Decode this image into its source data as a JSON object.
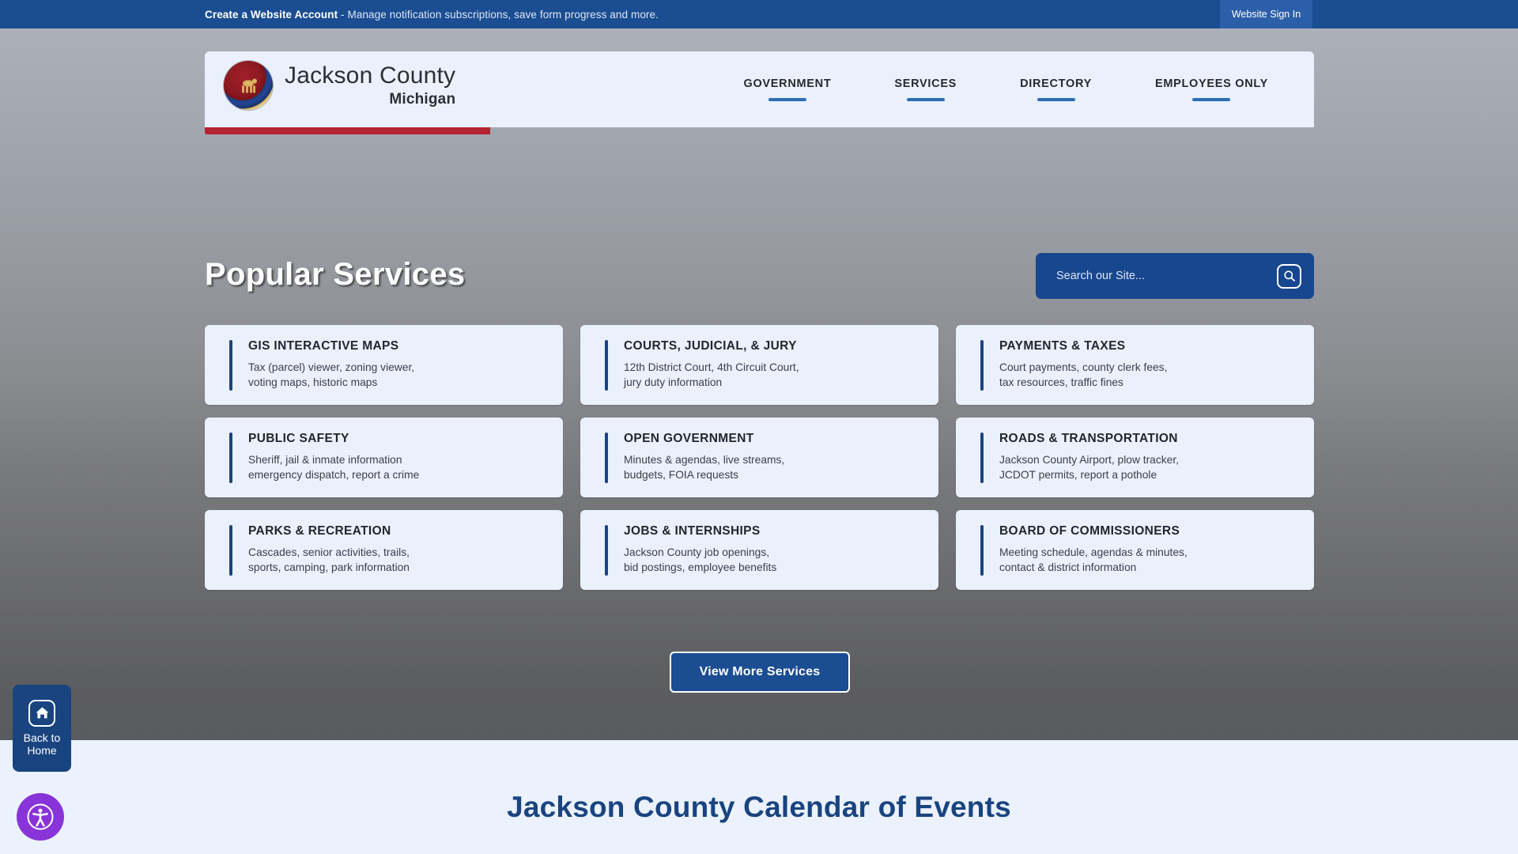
{
  "topbar": {
    "account_link": "Create a Website Account",
    "account_tagline": " - Manage notification subscriptions, save form progress and more.",
    "signin_label": "Website Sign In"
  },
  "header": {
    "brand_name": "Jackson County",
    "brand_state": "Michigan",
    "seal_icon": "county-seal-horse-icon",
    "nav": [
      {
        "label": "GOVERNMENT"
      },
      {
        "label": "SERVICES"
      },
      {
        "label": "DIRECTORY"
      },
      {
        "label": "EMPLOYEES ONLY"
      }
    ]
  },
  "hero": {
    "section_title": "Popular Services",
    "search_placeholder": "Search our Site...",
    "search_value": "",
    "search_icon": "magnifier-icon"
  },
  "services": [
    {
      "title": "GIS INTERACTIVE MAPS",
      "line1": "Tax (parcel) viewer, zoning viewer,",
      "line2": "voting maps, historic maps"
    },
    {
      "title": "COURTS, JUDICIAL, & JURY",
      "line1": "12th District Court, 4th Circuit Court,",
      "line2": "jury duty information"
    },
    {
      "title": "PAYMENTS & TAXES",
      "line1": "Court payments, county clerk fees,",
      "line2": "tax resources, traffic fines"
    },
    {
      "title": "PUBLIC SAFETY",
      "line1": "Sheriff, jail & inmate information",
      "line2": "emergency dispatch, report a crime"
    },
    {
      "title": "OPEN GOVERNMENT",
      "line1": "Minutes & agendas, live streams,",
      "line2": "budgets, FOIA requests"
    },
    {
      "title": "ROADS & TRANSPORTATION",
      "line1": "Jackson County Airport, plow tracker,",
      "line2": "JCDOT permits, report a pothole"
    },
    {
      "title": "PARKS & RECREATION",
      "line1": "Cascades, senior activities, trails,",
      "line2": "sports, camping, park information"
    },
    {
      "title": "JOBS & INTERNSHIPS",
      "line1": "Jackson County job openings,",
      "line2": "bid postings, employee benefits"
    },
    {
      "title": "BOARD OF COMMISSIONERS",
      "line1": "Meeting schedule, agendas & minutes,",
      "line2": "contact & district information"
    }
  ],
  "actions": {
    "view_more_label": "View More Services"
  },
  "calendar": {
    "heading": "Jackson County Calendar of Events"
  },
  "widgets": {
    "back_home_line1": "Back to",
    "back_home_line2": "Home",
    "home_icon": "home-icon",
    "accessibility_icon": "accessibility-person-icon"
  },
  "colors": {
    "brand_blue": "#1a4d92",
    "navy": "#1a4480",
    "accent_red": "#b4232f",
    "card_bg": "#eaf1fd",
    "nav_underline": "#2c6cb5",
    "accessibility_purple": "#8834d8"
  }
}
